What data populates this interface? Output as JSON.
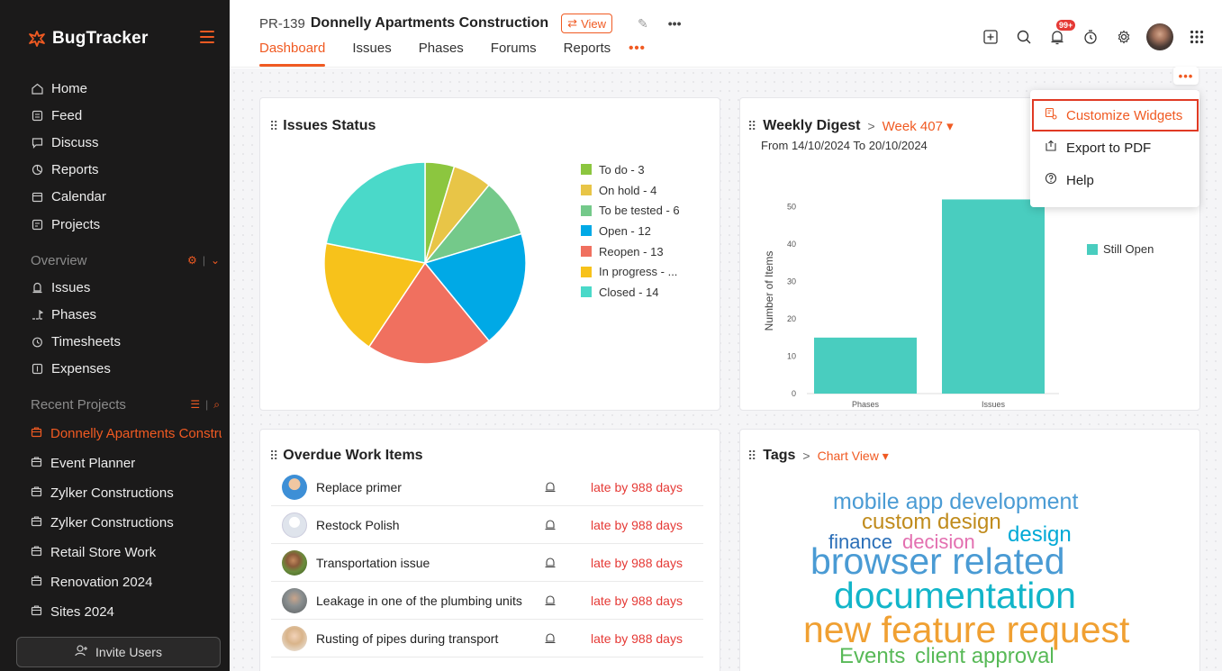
{
  "app": {
    "name": "BugTracker"
  },
  "sidebar": {
    "nav": [
      {
        "label": "Home",
        "icon": "home-icon"
      },
      {
        "label": "Feed",
        "icon": "feed-icon"
      },
      {
        "label": "Discuss",
        "icon": "discuss-icon"
      },
      {
        "label": "Reports",
        "icon": "reports-icon"
      },
      {
        "label": "Calendar",
        "icon": "calendar-icon"
      },
      {
        "label": "Projects",
        "icon": "projects-icon"
      }
    ],
    "overview_label": "Overview",
    "overview_items": [
      {
        "label": "Issues",
        "icon": "issues-icon"
      },
      {
        "label": "Phases",
        "icon": "phases-icon"
      },
      {
        "label": "Timesheets",
        "icon": "timesheets-icon"
      },
      {
        "label": "Expenses",
        "icon": "expenses-icon"
      }
    ],
    "recent_label": "Recent Projects",
    "recent_projects": [
      {
        "label": "Donnelly Apartments Construction",
        "active": true
      },
      {
        "label": "Event Planner"
      },
      {
        "label": "Zylker Constructions"
      },
      {
        "label": "Zylker Constructions"
      },
      {
        "label": "Retail Store Work"
      },
      {
        "label": "Renovation 2024"
      },
      {
        "label": "Sites 2024"
      }
    ],
    "invite_label": "Invite Users"
  },
  "header": {
    "project_id": "PR-139",
    "project_title": "Donnelly Apartments Construction",
    "view_label": "View",
    "more_label": "•••",
    "tabs": [
      {
        "label": "Dashboard",
        "active": true
      },
      {
        "label": "Issues"
      },
      {
        "label": "Phases"
      },
      {
        "label": "Forums"
      },
      {
        "label": "Reports"
      }
    ],
    "tabs_more": "•••",
    "notification_badge": "99+"
  },
  "menu": {
    "dots": "•••",
    "items": [
      {
        "label": "Customize Widgets",
        "icon": "customize-icon",
        "highlighted": true
      },
      {
        "label": "Export to PDF",
        "icon": "export-icon"
      },
      {
        "label": "Help",
        "icon": "help-icon"
      }
    ]
  },
  "issues_status": {
    "title": "Issues Status",
    "legend": [
      {
        "label": "To do - 3",
        "color": "#8cc63f"
      },
      {
        "label": "On hold - 4",
        "color": "#e8c547"
      },
      {
        "label": "To be tested - 6",
        "color": "#74c98a"
      },
      {
        "label": "Open - 12",
        "color": "#00a9e6"
      },
      {
        "label": "Reopen - 13",
        "color": "#f0705f"
      },
      {
        "label": "In progress - ...",
        "color": "#f7c21b"
      },
      {
        "label": "Closed - 14",
        "color": "#4ad9c9"
      }
    ]
  },
  "weekly_digest": {
    "title": "Weekly Digest",
    "week_label": "Week 407",
    "range": "From 14/10/2024 To 20/10/2024",
    "legend_visible": "Still Open"
  },
  "overdue": {
    "title": "Overdue Work Items",
    "rows": [
      {
        "name": "Replace primer",
        "status": "late by 988 days",
        "avatar": "#3d8fd6"
      },
      {
        "name": "Restock Polish",
        "status": "late by 988 days",
        "avatar": "#dfe4ec"
      },
      {
        "name": "Transportation issue",
        "status": "late by 988 days",
        "avatar": "#6a8c3c"
      },
      {
        "name": "Leakage in one of the plumbing units",
        "status": "late by 988 days",
        "avatar": "#8a8f90"
      },
      {
        "name": "Rusting of pipes during transport",
        "status": "late by 988 days",
        "avatar": "#d9b48a"
      }
    ]
  },
  "tags": {
    "title": "Tags",
    "view_label": "Chart View",
    "words": [
      {
        "text": "mobile app development",
        "color": "#4a9bd4"
      },
      {
        "text": "custom design",
        "color": "#c08b1c"
      },
      {
        "text": "design",
        "color": "#00a9d6"
      },
      {
        "text": "finance",
        "color": "#2b6fb8"
      },
      {
        "text": "decision",
        "color": "#e36fb0"
      },
      {
        "text": "browser related",
        "color": "#4a9bd4"
      },
      {
        "text": "documentation",
        "color": "#12b5c9"
      },
      {
        "text": "new feature request",
        "color": "#f0a032"
      },
      {
        "text": "Events",
        "color": "#58b957"
      },
      {
        "text": "client approval",
        "color": "#58b957"
      }
    ]
  },
  "chart_data": [
    {
      "type": "pie",
      "title": "Issues Status",
      "categories": [
        "To do",
        "On hold",
        "To be tested",
        "Open",
        "Reopen",
        "In progress",
        "Closed"
      ],
      "values": [
        3,
        4,
        6,
        12,
        13,
        12,
        14
      ],
      "colors": [
        "#8cc63f",
        "#e8c547",
        "#74c98a",
        "#00a9e6",
        "#f0705f",
        "#f7c21b",
        "#4ad9c9"
      ],
      "legend_position": "right"
    },
    {
      "type": "bar",
      "title": "Weekly Digest",
      "categories": [
        "Phases",
        "Issues"
      ],
      "series": [
        {
          "name": "Still Open",
          "values": [
            15,
            52
          ],
          "color": "#49cdbf"
        }
      ],
      "ylabel": "Number of Items",
      "yticks": [
        0,
        10,
        20,
        30,
        40,
        50
      ],
      "ylim": [
        0,
        55
      ]
    }
  ]
}
